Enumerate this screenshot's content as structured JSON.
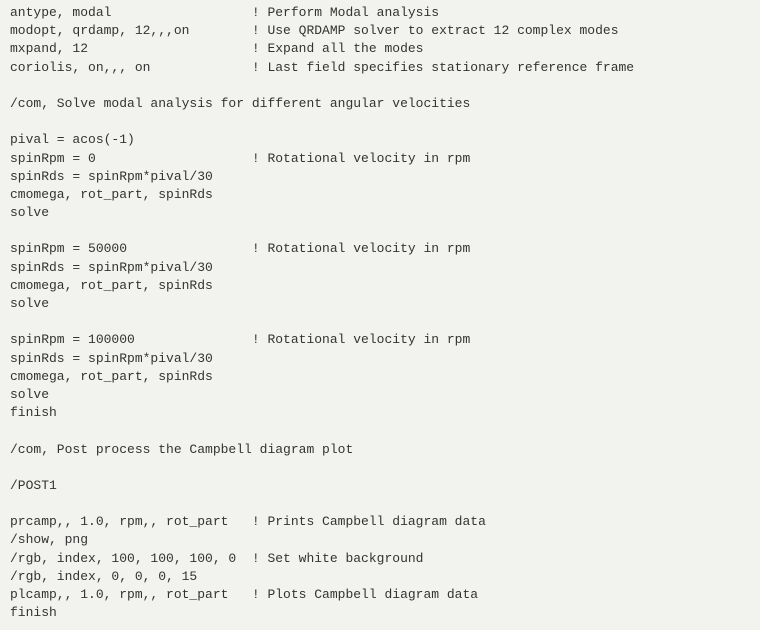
{
  "lines": [
    "antype, modal                  ! Perform Modal analysis",
    "modopt, qrdamp, 12,,,on        ! Use QRDAMP solver to extract 12 complex modes",
    "mxpand, 12                     ! Expand all the modes",
    "coriolis, on,,, on             ! Last field specifies stationary reference frame",
    "",
    "/com, Solve modal analysis for different angular velocities",
    "",
    "pival = acos(-1)",
    "spinRpm = 0                    ! Rotational velocity in rpm",
    "spinRds = spinRpm*pival/30",
    "cmomega, rot_part, spinRds",
    "solve",
    "",
    "spinRpm = 50000                ! Rotational velocity in rpm",
    "spinRds = spinRpm*pival/30",
    "cmomega, rot_part, spinRds",
    "solve",
    "",
    "spinRpm = 100000               ! Rotational velocity in rpm",
    "spinRds = spinRpm*pival/30",
    "cmomega, rot_part, spinRds",
    "solve",
    "finish",
    "",
    "/com, Post process the Campbell diagram plot",
    "",
    "/POST1",
    "",
    "prcamp,, 1.0, rpm,, rot_part   ! Prints Campbell diagram data",
    "/show, png",
    "/rgb, index, 100, 100, 100, 0  ! Set white background",
    "/rgb, index, 0, 0, 0, 15",
    "plcamp,, 1.0, rpm,, rot_part   ! Plots Campbell diagram data",
    "finish"
  ]
}
